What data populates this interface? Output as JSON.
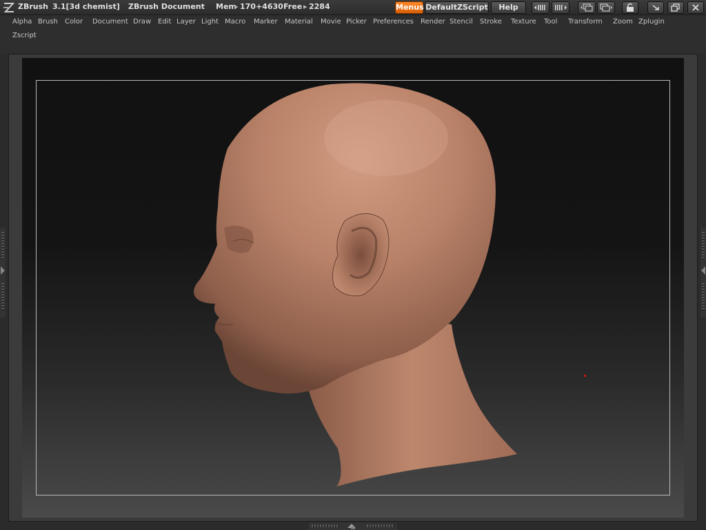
{
  "app": {
    "name": "ZBrush",
    "version": "3.1[3d chemist]",
    "document": "ZBrush Document",
    "mem_label": "Mem",
    "mem_value": "170+4630",
    "free_label": "Free",
    "free_value": "2284"
  },
  "title_buttons": {
    "menus": "Menus",
    "script": "DefaultZScript",
    "help": "Help"
  },
  "menus": [
    "Alpha",
    "Brush",
    "Color",
    "Document",
    "Draw",
    "Edit",
    "Layer",
    "Light",
    "Macro",
    "Marker",
    "Material",
    "Movie",
    "Picker",
    "Preferences",
    "Render",
    "Stencil",
    "Stroke",
    "Texture",
    "Tool",
    "Transform",
    "Zoom",
    "Zplugin",
    "Zscript"
  ],
  "colors": {
    "accent": "#ef7411",
    "skin": "#b9836c",
    "marker": "#d01010"
  },
  "icons": [
    "zbrush-logo-icon",
    "shrink-left-icon",
    "shrink-right-icon",
    "layout-icon",
    "layout-alt-icon",
    "lock-icon",
    "minimize-icon",
    "restore-icon",
    "close-icon"
  ]
}
